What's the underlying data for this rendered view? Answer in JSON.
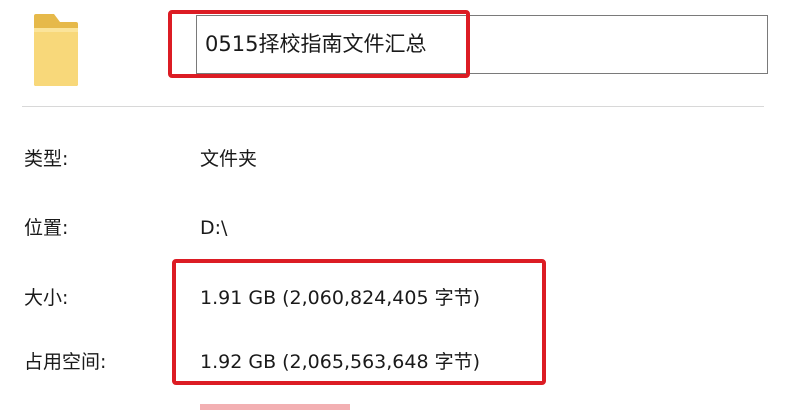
{
  "folder_name": "0515择校指南文件汇总",
  "icon": "folder-icon",
  "highlight_color": "#dc1c24",
  "properties": {
    "type": {
      "label": "类型:",
      "value": "文件夹"
    },
    "location": {
      "label": "位置:",
      "value": "D:\\"
    },
    "size": {
      "label": "大小:",
      "value": "1.91 GB (2,060,824,405 字节)"
    },
    "size_on_disk": {
      "label": "占用空间:",
      "value": "1.92 GB (2,065,563,648 字节)"
    }
  }
}
